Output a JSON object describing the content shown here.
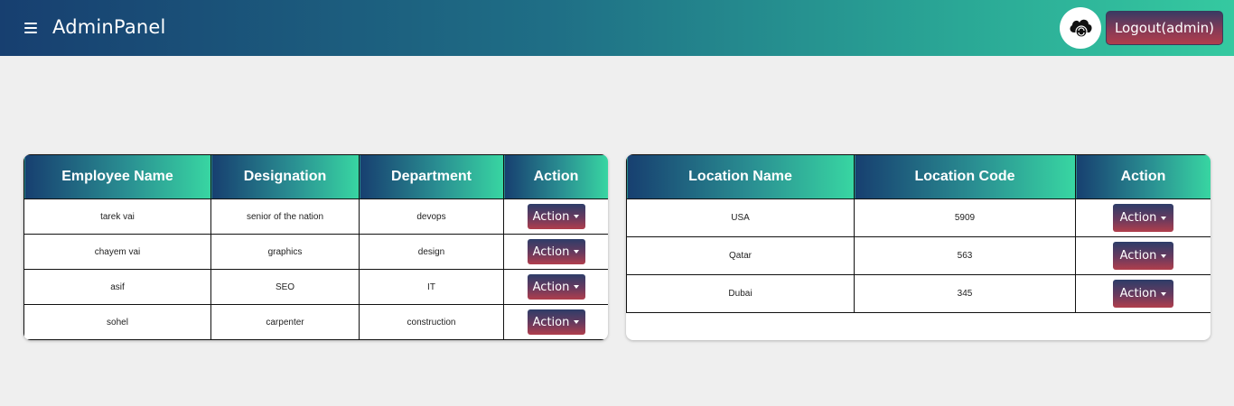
{
  "header": {
    "brand": "AdminPanel",
    "logout_label": "Logout(admin)"
  },
  "employees": {
    "columns": [
      "Employee Name",
      "Designation",
      "Department",
      "Action"
    ],
    "rows": [
      {
        "name": "tarek vai",
        "designation": "senior of the nation",
        "department": "devops",
        "action": "Action"
      },
      {
        "name": "chayem vai",
        "designation": "graphics",
        "department": "design",
        "action": "Action"
      },
      {
        "name": "asif",
        "designation": "SEO",
        "department": "IT",
        "action": "Action"
      },
      {
        "name": "sohel",
        "designation": "carpenter",
        "department": "construction",
        "action": "Action"
      }
    ]
  },
  "locations": {
    "columns": [
      "Location Name",
      "Location Code",
      "Action"
    ],
    "rows": [
      {
        "name": "USA",
        "code": "5909",
        "action": "Action"
      },
      {
        "name": "Qatar",
        "code": "563",
        "action": "Action"
      },
      {
        "name": "Dubai",
        "code": "345",
        "action": "Action"
      }
    ]
  },
  "colors": {
    "header_gradient_start": "#173f70",
    "header_gradient_end": "#35c9a0",
    "button_gradient_top": "#2d3d69",
    "button_gradient_bottom": "#b03e4c"
  },
  "icons": {
    "menu": "hamburger-icon",
    "avatar": "cloud-sync-icon",
    "dropdown": "caret-down-icon"
  }
}
